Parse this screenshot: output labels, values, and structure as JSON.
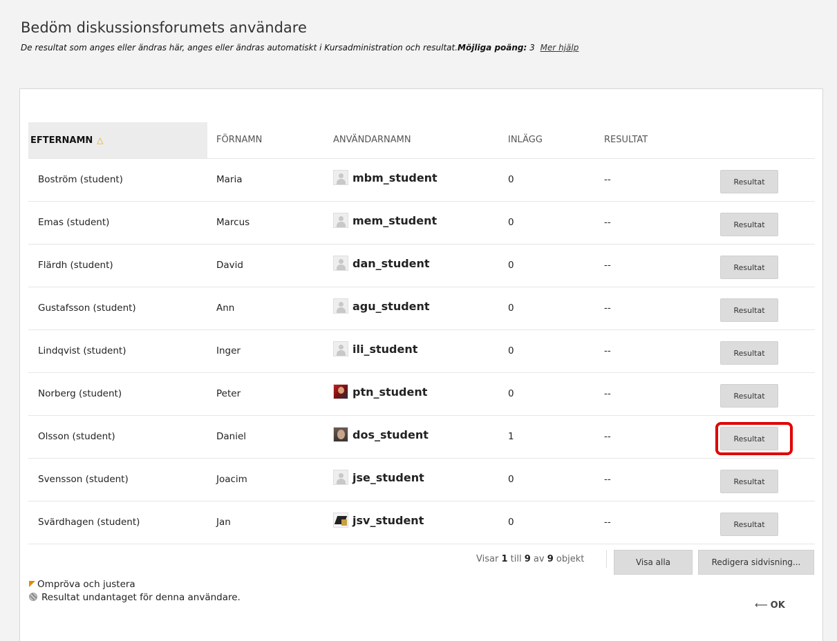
{
  "page": {
    "title": "Bedöm diskussionsforumets användare",
    "subtitle_text": "De resultat som anges eller ändras här, anges eller ändras automatiskt i Kursadministration och resultat.",
    "points_label": "Möjliga poäng:",
    "points_value": "3",
    "help_link": "Mer hjälp"
  },
  "table": {
    "columns": {
      "last_name": "EFTERNAMN",
      "first_name": "FÖRNAMN",
      "username": "ANVÄNDARNAMN",
      "posts": "INLÄGG",
      "grade": "RESULTAT"
    },
    "sort_icon": "sort-ascending-icon",
    "rows": [
      {
        "last_name": "Boström (student)",
        "first_name": "Maria",
        "username": "mbm_student",
        "posts": "0",
        "grade": "--",
        "action": "Resultat",
        "avatar": "default-avatar-icon"
      },
      {
        "last_name": "Emas (student)",
        "first_name": "Marcus",
        "username": "mem_student",
        "posts": "0",
        "grade": "--",
        "action": "Resultat",
        "avatar": "default-avatar-icon"
      },
      {
        "last_name": "Flärdh (student)",
        "first_name": "David",
        "username": "dan_student",
        "posts": "0",
        "grade": "--",
        "action": "Resultat",
        "avatar": "default-avatar-icon"
      },
      {
        "last_name": "Gustafsson (student)",
        "first_name": "Ann",
        "username": "agu_student",
        "posts": "0",
        "grade": "--",
        "action": "Resultat",
        "avatar": "default-avatar-icon"
      },
      {
        "last_name": "Lindqvist (student)",
        "first_name": "Inger",
        "username": "ili_student",
        "posts": "0",
        "grade": "--",
        "action": "Resultat",
        "avatar": "default-avatar-icon"
      },
      {
        "last_name": "Norberg (student)",
        "first_name": "Peter",
        "username": "ptn_student",
        "posts": "0",
        "grade": "--",
        "action": "Resultat",
        "avatar": "photo-avatar-icon"
      },
      {
        "last_name": "Olsson (student)",
        "first_name": "Daniel",
        "username": "dos_student",
        "posts": "1",
        "grade": "--",
        "action": "Resultat",
        "avatar": "photo-avatar-icon",
        "highlighted": true
      },
      {
        "last_name": "Svensson (student)",
        "first_name": "Joacim",
        "username": "jse_student",
        "posts": "0",
        "grade": "--",
        "action": "Resultat",
        "avatar": "default-avatar-icon"
      },
      {
        "last_name": "Svärdhagen (student)",
        "first_name": "Jan",
        "username": "jsv_student",
        "posts": "0",
        "grade": "--",
        "action": "Resultat",
        "avatar": "photo-avatar-icon"
      }
    ]
  },
  "pager": {
    "prefix": "Visar",
    "from": "1",
    "mid": "till",
    "to": "9",
    "of": "av",
    "total": "9",
    "suffix": "objekt",
    "show_all": "Visa alla",
    "edit_paging": "Redigera sidvisning..."
  },
  "legend": {
    "review": "Ompröva och justera",
    "exempt": "Resultat undantaget för denna användare."
  },
  "footer": {
    "ok": "OK"
  },
  "colors": {
    "highlight": "#e00000",
    "sort_icon": "#e0a800",
    "flag": "#e08a00"
  }
}
